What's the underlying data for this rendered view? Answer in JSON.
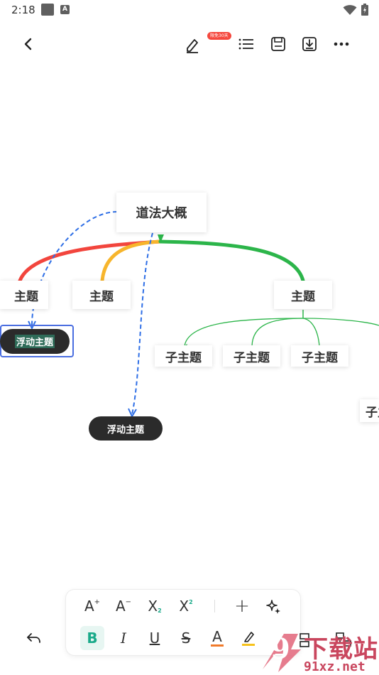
{
  "status_bar": {
    "time": "2:18",
    "notification_icon": "A"
  },
  "toolbar": {
    "back_icon": "chevron-left-icon",
    "edit_icon": "pen-icon",
    "promo_badge": "限免30天",
    "outline_icon": "list-icon",
    "save_icon": "save-icon",
    "export_icon": "download-icon",
    "more_icon": "more-icon"
  },
  "mindmap": {
    "root": "道法大概",
    "topics": [
      "主题",
      "主题",
      "主题"
    ],
    "subtopics": [
      "子主题",
      "子主题",
      "子主题",
      "子主题"
    ],
    "floating_topics": [
      "浮动主题",
      "浮动主题"
    ],
    "branch_colors": {
      "red": "#f2453d",
      "orange": "#f7b52c",
      "green": "#2cb54a",
      "link_dashed": "#2f6fe6",
      "selection": "#4a6ee0"
    }
  },
  "format_toolbar": {
    "font_increase": "A",
    "font_decrease": "A",
    "subscript": "X",
    "superscript": "X",
    "add": "+",
    "sparkle_icon": "sparkle-icon",
    "bold": "B",
    "italic": "I",
    "underline": "U",
    "strike": "S",
    "font_color": "A",
    "highlight_icon": "highlighter-icon",
    "accent_color": "#1aaa8a"
  },
  "watermark": {
    "logo_char": "9",
    "title": "下载站",
    "url": "91xz.net"
  }
}
